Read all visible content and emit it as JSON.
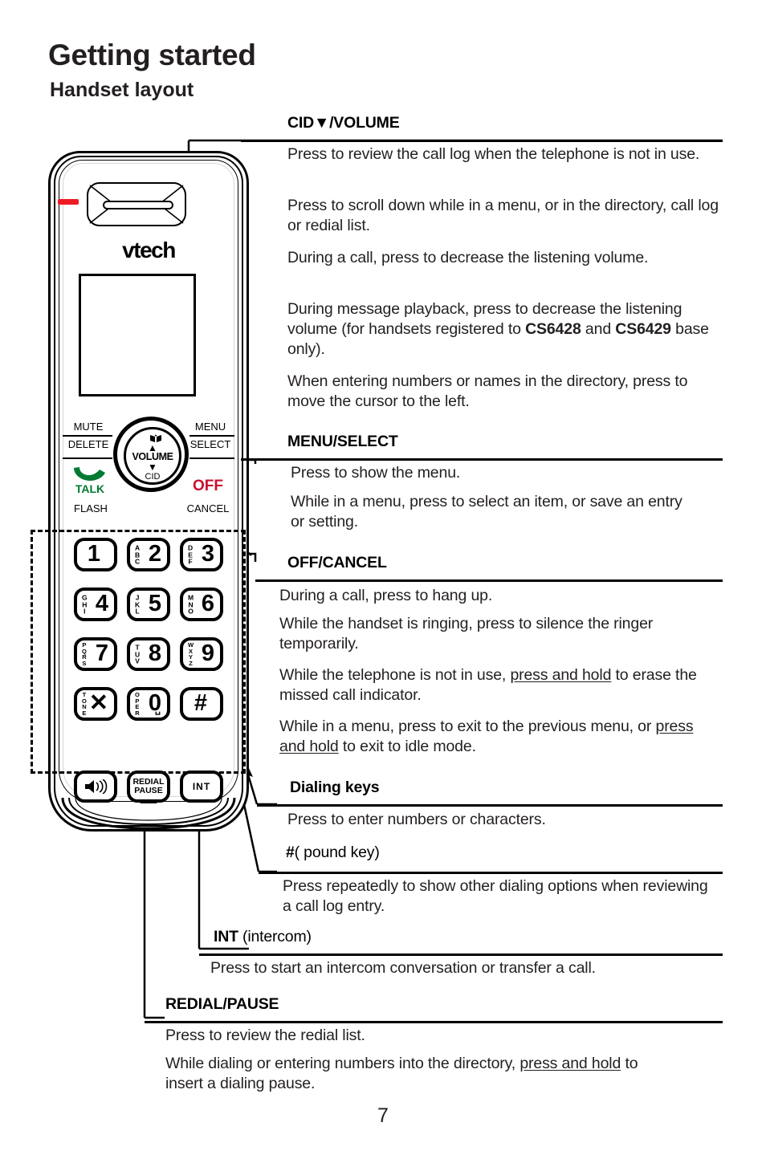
{
  "page": {
    "chapter_title": "Getting started",
    "section_title": "Handset layout",
    "page_number": "7"
  },
  "handset": {
    "brand": "vtech",
    "led_color": "#ed1c24",
    "talk_color": "#007a33",
    "off_color": "#c8102e",
    "function_keys": {
      "mute": "MUTE",
      "delete": "DELETE",
      "menu": "MENU",
      "select": "SELECT",
      "talk": "TALK",
      "flash": "FLASH",
      "off": "OFF",
      "cancel": "CANCEL"
    },
    "navpad": {
      "directory_icon": "directory-book-icon",
      "up_arrow": "▲",
      "label": "VOLUME",
      "down_arrow": "▼",
      "cid": "CID"
    },
    "keypad": [
      {
        "digit": "1",
        "letters": ""
      },
      {
        "digit": "2",
        "letters": "ABC"
      },
      {
        "digit": "3",
        "letters": "DEF"
      },
      {
        "digit": "4",
        "letters": "GHI"
      },
      {
        "digit": "5",
        "letters": "JKL"
      },
      {
        "digit": "6",
        "letters": "MNO"
      },
      {
        "digit": "7",
        "letters": "PQRS"
      },
      {
        "digit": "8",
        "letters": "TUV"
      },
      {
        "digit": "9",
        "letters": "WXYZ"
      },
      {
        "digit": "✕",
        "letters": "TONE"
      },
      {
        "digit": "0",
        "letters": "OPER"
      },
      {
        "digit": "#",
        "letters": ""
      }
    ],
    "soft_keys": {
      "speaker": "speaker-icon",
      "redial_line1": "REDIAL",
      "redial_line2": "PAUSE",
      "int": "INT"
    }
  },
  "sections": {
    "cid_volume": {
      "title": "CID▼/VOLUME",
      "paragraphs": [
        "Press to review the call log when the telephone is not in use.",
        "Press to scroll down while in a menu, or in the directory, call log or redial list.",
        "During a call, press to decrease the listening volume.",
        "During message playback, press to decrease the listening volume (for handsets registered to CS6428 and CS6429 base only).",
        "When entering numbers or names in the directory, press to move the cursor to the left."
      ]
    },
    "menu_select": {
      "title": "MENU/SELECT",
      "paragraphs": [
        "Press to show the menu.",
        "While in a menu, press to select an item, or save an entry or setting."
      ]
    },
    "off_cancel": {
      "title": "OFF/CANCEL",
      "paragraphs": [
        "During a call, press to hang up.",
        "While the handset is ringing, press to silence the ringer temporarily.",
        "While the telephone is not in use, press and hold to erase the missed call indicator.",
        "While in a menu, press to exit to the previous menu, or press and hold to exit to idle mode."
      ]
    },
    "dialing_keys": {
      "title": "Dialing keys",
      "paragraphs": [
        "Press to enter numbers or characters."
      ]
    },
    "pound_key": {
      "title_bold": "#",
      "title_rest": "( pound key)",
      "paragraphs": [
        "Press repeatedly to show other dialing options when reviewing a call log entry."
      ]
    },
    "int": {
      "title_bold": "INT",
      "title_rest": " (intercom)",
      "paragraphs": [
        "Press to start an intercom conversation or transfer a call."
      ]
    },
    "redial_pause": {
      "title": "REDIAL/PAUSE",
      "paragraphs": [
        "Press to review the redial list.",
        "While dialing or entering numbers into the directory, press and hold to insert a dialing pause."
      ]
    }
  }
}
